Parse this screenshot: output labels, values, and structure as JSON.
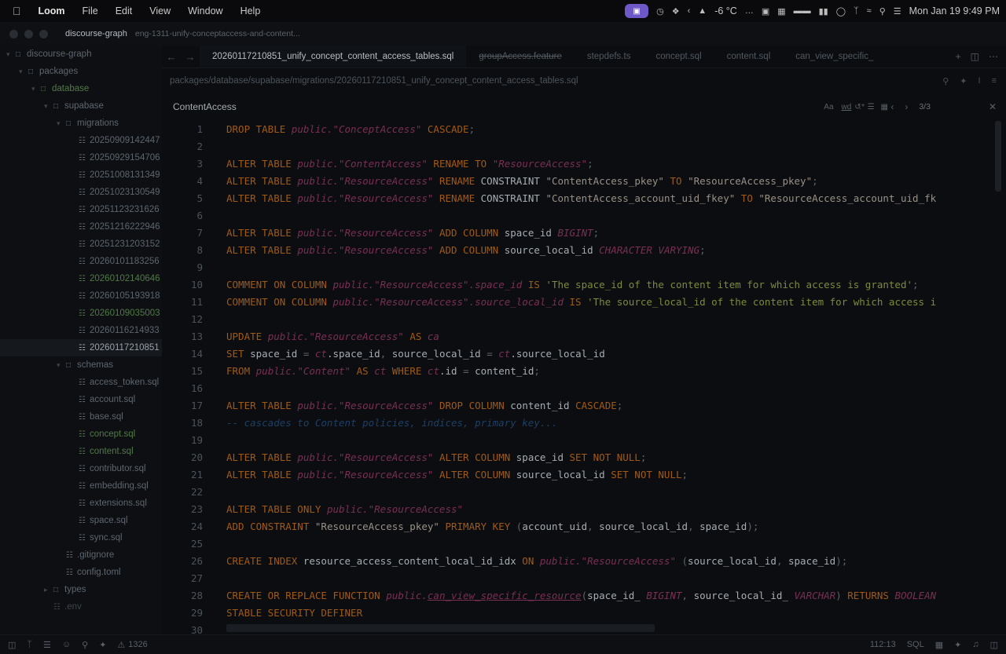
{
  "menubar": {
    "app": "Loom",
    "items": [
      "File",
      "Edit",
      "View",
      "Window",
      "Help"
    ],
    "weather": "-6 °C",
    "datetime": "Mon Jan 19  9:49 PM"
  },
  "titlebar": {
    "project": "discourse-graph",
    "branch": "eng-1311-unify-conceptaccess-and-content..."
  },
  "sidebar": {
    "rows": [
      {
        "label": "discourse-graph",
        "depth": 0,
        "kind": "folder-open"
      },
      {
        "label": "packages",
        "depth": 1,
        "kind": "folder-open"
      },
      {
        "label": "database",
        "depth": 2,
        "kind": "folder-open",
        "green": true
      },
      {
        "label": "supabase",
        "depth": 3,
        "kind": "folder-open"
      },
      {
        "label": "migrations",
        "depth": 4,
        "kind": "folder-open"
      },
      {
        "label": "20250909142447",
        "depth": 5,
        "kind": "file"
      },
      {
        "label": "20250929154706",
        "depth": 5,
        "kind": "file"
      },
      {
        "label": "20251008131349",
        "depth": 5,
        "kind": "file"
      },
      {
        "label": "20251023130549",
        "depth": 5,
        "kind": "file"
      },
      {
        "label": "20251123231626",
        "depth": 5,
        "kind": "file"
      },
      {
        "label": "20251216222946",
        "depth": 5,
        "kind": "file"
      },
      {
        "label": "20251231203152",
        "depth": 5,
        "kind": "file"
      },
      {
        "label": "20260101183256",
        "depth": 5,
        "kind": "file"
      },
      {
        "label": "20260102140646",
        "depth": 5,
        "kind": "file",
        "green": true
      },
      {
        "label": "20260105193918",
        "depth": 5,
        "kind": "file"
      },
      {
        "label": "20260109035003",
        "depth": 5,
        "kind": "file",
        "green": true
      },
      {
        "label": "20260116214933",
        "depth": 5,
        "kind": "file"
      },
      {
        "label": "20260117210851",
        "depth": 5,
        "kind": "file",
        "active": true
      },
      {
        "label": "schemas",
        "depth": 4,
        "kind": "folder-open"
      },
      {
        "label": "access_token.sql",
        "depth": 5,
        "kind": "file"
      },
      {
        "label": "account.sql",
        "depth": 5,
        "kind": "file"
      },
      {
        "label": "base.sql",
        "depth": 5,
        "kind": "file"
      },
      {
        "label": "concept.sql",
        "depth": 5,
        "kind": "file",
        "green": true
      },
      {
        "label": "content.sql",
        "depth": 5,
        "kind": "file",
        "green": true
      },
      {
        "label": "contributor.sql",
        "depth": 5,
        "kind": "file"
      },
      {
        "label": "embedding.sql",
        "depth": 5,
        "kind": "file"
      },
      {
        "label": "extensions.sql",
        "depth": 5,
        "kind": "file"
      },
      {
        "label": "space.sql",
        "depth": 5,
        "kind": "file"
      },
      {
        "label": "sync.sql",
        "depth": 5,
        "kind": "file"
      },
      {
        "label": ".gitignore",
        "depth": 4,
        "kind": "file"
      },
      {
        "label": "config.toml",
        "depth": 4,
        "kind": "file"
      },
      {
        "label": "types",
        "depth": 3,
        "kind": "folder"
      },
      {
        "label": ".env",
        "depth": 3,
        "kind": "file",
        "dim": true
      }
    ]
  },
  "tabs": [
    {
      "label": "20260117210851_unify_concept_content_access_tables.sql",
      "active": true
    },
    {
      "label": "groupAccess.feature",
      "strike": true
    },
    {
      "label": "stepdefs.ts"
    },
    {
      "label": "concept.sql"
    },
    {
      "label": "content.sql"
    },
    {
      "label": "can_view_specific_"
    }
  ],
  "breadcrumb": "packages/database/supabase/migrations/20260117210851_unify_concept_content_access_tables.sql",
  "find": {
    "query": "ContentAccess",
    "opt_case": "Aa",
    "opt_word": "wd",
    "count": "3/3"
  },
  "code_lines": [
    {
      "n": "1",
      "parts": [
        [
          "k",
          "DROP TABLE "
        ],
        [
          "it",
          "public."
        ],
        [
          "it",
          "\"ConceptAccess\""
        ],
        [
          "k",
          " CASCADE"
        ],
        [
          "p",
          ";"
        ]
      ]
    },
    {
      "n": "2",
      "parts": []
    },
    {
      "n": "3",
      "parts": [
        [
          "k",
          "ALTER TABLE "
        ],
        [
          "it",
          "public."
        ],
        [
          "it",
          "\"ContentAccess\""
        ],
        [
          "k",
          " RENAME TO "
        ],
        [
          "it",
          "\"ResourceAccess\""
        ],
        [
          "p",
          ";"
        ]
      ]
    },
    {
      "n": "4",
      "parts": [
        [
          "k",
          "ALTER TABLE "
        ],
        [
          "it",
          "public."
        ],
        [
          "it",
          "\"ResourceAccess\""
        ],
        [
          "k",
          " RENAME "
        ],
        [
          "id",
          "CONSTRAINT "
        ],
        [
          "s",
          "\"ContentAccess_pkey\""
        ],
        [
          "k",
          " TO "
        ],
        [
          "s",
          "\"ResourceAccess_pkey\""
        ],
        [
          "p",
          ";"
        ]
      ]
    },
    {
      "n": "5",
      "parts": [
        [
          "k",
          "ALTER TABLE "
        ],
        [
          "it",
          "public."
        ],
        [
          "it",
          "\"ResourceAccess\""
        ],
        [
          "k",
          " RENAME "
        ],
        [
          "id",
          "CONSTRAINT "
        ],
        [
          "s",
          "\"ContentAccess_account_uid_fkey\""
        ],
        [
          "k",
          " TO "
        ],
        [
          "s",
          "\"ResourceAccess_account_uid_fk"
        ]
      ]
    },
    {
      "n": "6",
      "parts": []
    },
    {
      "n": "7",
      "parts": [
        [
          "k",
          "ALTER TABLE "
        ],
        [
          "it",
          "public."
        ],
        [
          "it",
          "\"ResourceAccess\""
        ],
        [
          "k",
          " ADD COLUMN "
        ],
        [
          "id",
          "space_id "
        ],
        [
          "it",
          "BIGINT"
        ],
        [
          "p",
          ";"
        ]
      ]
    },
    {
      "n": "8",
      "parts": [
        [
          "k",
          "ALTER TABLE "
        ],
        [
          "it",
          "public."
        ],
        [
          "it",
          "\"ResourceAccess\""
        ],
        [
          "k",
          " ADD COLUMN "
        ],
        [
          "id",
          "source_local_id "
        ],
        [
          "it",
          "CHARACTER VARYING"
        ],
        [
          "p",
          ";"
        ]
      ]
    },
    {
      "n": "9",
      "parts": []
    },
    {
      "n": "10",
      "parts": [
        [
          "k",
          "COMMENT ON COLUMN "
        ],
        [
          "it",
          "public."
        ],
        [
          "it",
          "\"ResourceAccess\""
        ],
        [
          "it",
          ".space_id"
        ],
        [
          "k",
          " IS "
        ],
        [
          "str",
          "'The space_id of the content item for which access is granted'"
        ],
        [
          "p",
          ";"
        ]
      ]
    },
    {
      "n": "11",
      "parts": [
        [
          "k",
          "COMMENT ON COLUMN "
        ],
        [
          "it",
          "public."
        ],
        [
          "it",
          "\"ResourceAccess\""
        ],
        [
          "it",
          ".source_local_id"
        ],
        [
          "k",
          " IS "
        ],
        [
          "str",
          "'The source_local_id of the content item for which access i"
        ]
      ]
    },
    {
      "n": "12",
      "parts": []
    },
    {
      "n": "13",
      "parts": [
        [
          "k",
          "UPDATE "
        ],
        [
          "it",
          "public."
        ],
        [
          "it",
          "\"ResourceAccess\""
        ],
        [
          "k",
          " AS "
        ],
        [
          "it",
          "ca"
        ]
      ]
    },
    {
      "n": "14",
      "parts": [
        [
          "k",
          "SET "
        ],
        [
          "id",
          "space_id "
        ],
        [
          "p",
          "= "
        ],
        [
          "it",
          "ct"
        ],
        [
          "id",
          ".space_id"
        ],
        [
          "p",
          ", "
        ],
        [
          "id",
          "source_local_id "
        ],
        [
          "p",
          "= "
        ],
        [
          "it",
          "ct"
        ],
        [
          "id",
          ".source_local_id"
        ]
      ]
    },
    {
      "n": "15",
      "parts": [
        [
          "k",
          "FROM "
        ],
        [
          "it",
          "public."
        ],
        [
          "it",
          "\"Content\""
        ],
        [
          "k",
          " AS "
        ],
        [
          "it",
          "ct"
        ],
        [
          "k",
          " WHERE "
        ],
        [
          "it",
          "ct"
        ],
        [
          "id",
          ".id "
        ],
        [
          "p",
          "= "
        ],
        [
          "id",
          "content_id"
        ],
        [
          "p",
          ";"
        ]
      ]
    },
    {
      "n": "16",
      "parts": []
    },
    {
      "n": "17",
      "parts": [
        [
          "k",
          "ALTER TABLE "
        ],
        [
          "it",
          "public."
        ],
        [
          "it",
          "\"ResourceAccess\""
        ],
        [
          "k",
          " DROP COLUMN "
        ],
        [
          "id",
          "content_id "
        ],
        [
          "k",
          "CASCADE"
        ],
        [
          "p",
          ";"
        ]
      ]
    },
    {
      "n": "18",
      "parts": [
        [
          "cm",
          "-- cascades to Content policies, indices, primary key..."
        ]
      ]
    },
    {
      "n": "19",
      "parts": []
    },
    {
      "n": "20",
      "parts": [
        [
          "k",
          "ALTER TABLE "
        ],
        [
          "it",
          "public."
        ],
        [
          "it",
          "\"ResourceAccess\""
        ],
        [
          "k",
          " ALTER COLUMN "
        ],
        [
          "id",
          "space_id "
        ],
        [
          "k",
          "SET NOT NULL"
        ],
        [
          "p",
          ";"
        ]
      ]
    },
    {
      "n": "21",
      "parts": [
        [
          "k",
          "ALTER TABLE "
        ],
        [
          "it",
          "public."
        ],
        [
          "it",
          "\"ResourceAccess\""
        ],
        [
          "k",
          " ALTER COLUMN "
        ],
        [
          "id",
          "source_local_id "
        ],
        [
          "k",
          "SET NOT NULL"
        ],
        [
          "p",
          ";"
        ]
      ]
    },
    {
      "n": "22",
      "parts": []
    },
    {
      "n": "23",
      "parts": [
        [
          "k",
          "ALTER TABLE ONLY "
        ],
        [
          "it",
          "public."
        ],
        [
          "it",
          "\"ResourceAccess\""
        ]
      ]
    },
    {
      "n": "24",
      "parts": [
        [
          "k",
          "ADD CONSTRAINT "
        ],
        [
          "s",
          "\"ResourceAccess_pkey\""
        ],
        [
          "k",
          " PRIMARY KEY "
        ],
        [
          "p",
          "("
        ],
        [
          "id",
          "account_uid"
        ],
        [
          "p",
          ", "
        ],
        [
          "id",
          "source_local_id"
        ],
        [
          "p",
          ", "
        ],
        [
          "id",
          "space_id"
        ],
        [
          "p",
          ");"
        ]
      ]
    },
    {
      "n": "25",
      "parts": []
    },
    {
      "n": "26",
      "parts": [
        [
          "k",
          "CREATE INDEX "
        ],
        [
          "id",
          "resource_access_content_local_id_idx "
        ],
        [
          "k",
          "ON "
        ],
        [
          "it",
          "public."
        ],
        [
          "it",
          "\"ResourceAccess\""
        ],
        [
          "p",
          " ("
        ],
        [
          "id",
          "source_local_id"
        ],
        [
          "p",
          ", "
        ],
        [
          "id",
          "space_id"
        ],
        [
          "p",
          ");"
        ]
      ]
    },
    {
      "n": "27",
      "parts": []
    },
    {
      "n": "28",
      "parts": [
        [
          "k",
          "CREATE OR REPLACE FUNCTION "
        ],
        [
          "it",
          "public."
        ],
        [
          "fn",
          "can_view_specific_resource"
        ],
        [
          "p",
          "("
        ],
        [
          "id",
          "space_id_ "
        ],
        [
          "it",
          "BIGINT"
        ],
        [
          "p",
          ", "
        ],
        [
          "id",
          "source_local_id_ "
        ],
        [
          "it",
          "VARCHAR"
        ],
        [
          "p",
          ") "
        ],
        [
          "k",
          "RETURNS "
        ],
        [
          "it",
          "BOOLEAN"
        ]
      ]
    },
    {
      "n": "29",
      "parts": [
        [
          "k",
          "STABLE SECURITY DEFINER"
        ]
      ]
    },
    {
      "n": "30",
      "parts": []
    }
  ],
  "statusbar": {
    "warnings": "1326",
    "position": "112:13",
    "language": "SQL"
  }
}
